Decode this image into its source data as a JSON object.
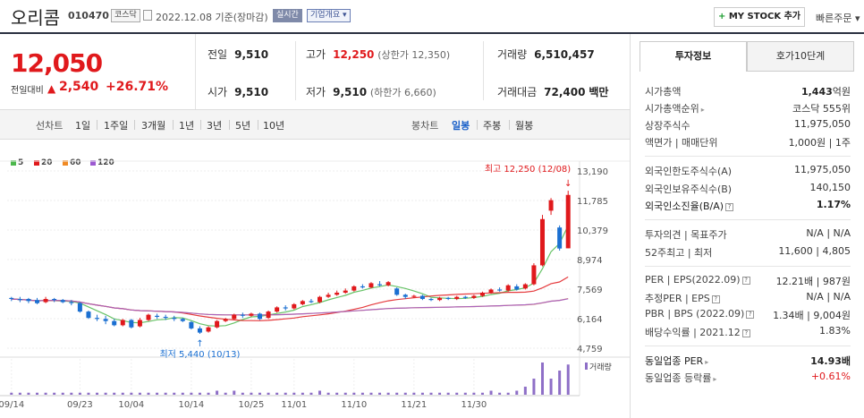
{
  "header": {
    "name": "오리콤",
    "code": "010470",
    "market_badge": "코스닥",
    "date_text": "2022.12.08 기준(장마감)",
    "realtime_badge": "실시간",
    "overview_badge": "기업개요 ▾",
    "my_stock_label": "MY STOCK 추가",
    "my_stock_plus": "+",
    "quick_order_label": "빠른주문 ▾"
  },
  "price": {
    "current": "12,050",
    "prev_label": "전일대비",
    "change_arrow": "▲",
    "change": "2,540",
    "rate": "+26.71%"
  },
  "summary": {
    "prev_close_label": "전일",
    "prev_close": "9,510",
    "high_label": "고가",
    "high": "12,250",
    "upper_limit": "(상한가 12,350)",
    "volume_label": "거래량",
    "volume": "6,510,457",
    "open_label": "시가",
    "open": "9,510",
    "low_label": "저가",
    "low": "9,510",
    "lower_limit": "(하한가 6,660)",
    "trade_value_label": "거래대금",
    "trade_value": "72,400",
    "trade_value_unit": "백만"
  },
  "range_bar": {
    "line_chart": "선차트",
    "ranges": [
      "1일",
      "1주일",
      "3개월",
      "1년",
      "3년",
      "5년",
      "10년"
    ],
    "candle_chart": "봉차트",
    "candles": [
      "일봉",
      "주봉",
      "월봉"
    ],
    "selected_candle": "일봉"
  },
  "legend": [
    {
      "label": "5",
      "color": "#4cb84c"
    },
    {
      "label": "20",
      "color": "#e0191c"
    },
    {
      "label": "60",
      "color": "#f08a24"
    },
    {
      "label": "120",
      "color": "#9c59d1"
    }
  ],
  "chart_data": {
    "type": "candlestick",
    "title": "",
    "x_ticks": [
      "09/14",
      "09/23",
      "10/04",
      "10/14",
      "10/25",
      "11/01",
      "11/10",
      "11/21",
      "11/30"
    ],
    "y_ticks": [
      13190,
      11785,
      10379,
      8974,
      7569,
      6164,
      4759
    ],
    "ylim": [
      4759,
      13190
    ],
    "high_annotation": "최고 12,250 (12/08)",
    "low_annotation": "최저 5,440 (10/13)",
    "volume_label": "거래량",
    "candles": [
      {
        "o": 7150,
        "c": 7100,
        "h": 7200,
        "l": 7000,
        "v": 1
      },
      {
        "o": 7100,
        "c": 7050,
        "h": 7200,
        "l": 6950,
        "v": 1
      },
      {
        "o": 7100,
        "c": 7000,
        "h": 7150,
        "l": 6900,
        "v": 1
      },
      {
        "o": 7050,
        "c": 6900,
        "h": 7150,
        "l": 6850,
        "v": 1
      },
      {
        "o": 6950,
        "c": 7100,
        "h": 7200,
        "l": 6900,
        "v": 1
      },
      {
        "o": 7100,
        "c": 7050,
        "h": 7150,
        "l": 6950,
        "v": 1
      },
      {
        "o": 7050,
        "c": 6950,
        "h": 7100,
        "l": 6900,
        "v": 1
      },
      {
        "o": 6950,
        "c": 6900,
        "h": 7050,
        "l": 6800,
        "v": 1
      },
      {
        "o": 6900,
        "c": 6500,
        "h": 6950,
        "l": 6450,
        "v": 1
      },
      {
        "o": 6500,
        "c": 6200,
        "h": 6550,
        "l": 6150,
        "v": 1
      },
      {
        "o": 6200,
        "c": 6150,
        "h": 6350,
        "l": 6050,
        "v": 1
      },
      {
        "o": 6150,
        "c": 6050,
        "h": 6300,
        "l": 5900,
        "v": 1
      },
      {
        "o": 6050,
        "c": 5850,
        "h": 6150,
        "l": 5800,
        "v": 1
      },
      {
        "o": 5850,
        "c": 6100,
        "h": 6150,
        "l": 5800,
        "v": 1
      },
      {
        "o": 6100,
        "c": 5750,
        "h": 6150,
        "l": 5700,
        "v": 1
      },
      {
        "o": 5800,
        "c": 6100,
        "h": 6200,
        "l": 5750,
        "v": 1
      },
      {
        "o": 6100,
        "c": 6350,
        "h": 6400,
        "l": 6050,
        "v": 1
      },
      {
        "o": 6300,
        "c": 6250,
        "h": 6400,
        "l": 6150,
        "v": 1
      },
      {
        "o": 6250,
        "c": 6200,
        "h": 6350,
        "l": 6100,
        "v": 1
      },
      {
        "o": 6200,
        "c": 6150,
        "h": 6300,
        "l": 6050,
        "v": 1
      },
      {
        "o": 6150,
        "c": 6050,
        "h": 6200,
        "l": 6000,
        "v": 1
      },
      {
        "o": 6000,
        "c": 5700,
        "h": 6050,
        "l": 5650,
        "v": 1
      },
      {
        "o": 5700,
        "c": 5500,
        "h": 5800,
        "l": 5440,
        "v": 1
      },
      {
        "o": 5550,
        "c": 5750,
        "h": 5800,
        "l": 5500,
        "v": 1
      },
      {
        "o": 5750,
        "c": 6050,
        "h": 6100,
        "l": 5700,
        "v": 2
      },
      {
        "o": 6050,
        "c": 6150,
        "h": 6200,
        "l": 6000,
        "v": 1
      },
      {
        "o": 6150,
        "c": 6350,
        "h": 6400,
        "l": 6100,
        "v": 2
      },
      {
        "o": 6350,
        "c": 6300,
        "h": 6450,
        "l": 6200,
        "v": 1
      },
      {
        "o": 6300,
        "c": 6400,
        "h": 6450,
        "l": 6250,
        "v": 1
      },
      {
        "o": 6400,
        "c": 6150,
        "h": 6450,
        "l": 6100,
        "v": 1
      },
      {
        "o": 6200,
        "c": 6500,
        "h": 6550,
        "l": 6150,
        "v": 1
      },
      {
        "o": 6500,
        "c": 6700,
        "h": 6750,
        "l": 6450,
        "v": 1
      },
      {
        "o": 6700,
        "c": 6650,
        "h": 6800,
        "l": 6550,
        "v": 1
      },
      {
        "o": 6650,
        "c": 6850,
        "h": 6900,
        "l": 6600,
        "v": 1
      },
      {
        "o": 6850,
        "c": 7000,
        "h": 7050,
        "l": 6800,
        "v": 1
      },
      {
        "o": 7000,
        "c": 6950,
        "h": 7100,
        "l": 6900,
        "v": 1
      },
      {
        "o": 6950,
        "c": 7200,
        "h": 7250,
        "l": 6900,
        "v": 2
      },
      {
        "o": 7200,
        "c": 7300,
        "h": 7400,
        "l": 7150,
        "v": 1
      },
      {
        "o": 7300,
        "c": 7400,
        "h": 7500,
        "l": 7250,
        "v": 1
      },
      {
        "o": 7400,
        "c": 7500,
        "h": 7600,
        "l": 7350,
        "v": 1
      },
      {
        "o": 7500,
        "c": 7700,
        "h": 7750,
        "l": 7450,
        "v": 1
      },
      {
        "o": 7700,
        "c": 7650,
        "h": 7800,
        "l": 7600,
        "v": 1
      },
      {
        "o": 7650,
        "c": 7850,
        "h": 7900,
        "l": 7600,
        "v": 1
      },
      {
        "o": 7800,
        "c": 7750,
        "h": 7950,
        "l": 7700,
        "v": 1
      },
      {
        "o": 7750,
        "c": 7900,
        "h": 7950,
        "l": 7700,
        "v": 1
      },
      {
        "o": 7600,
        "c": 7300,
        "h": 7650,
        "l": 7250,
        "v": 1
      },
      {
        "o": 7300,
        "c": 7200,
        "h": 7350,
        "l": 7100,
        "v": 1
      },
      {
        "o": 7200,
        "c": 7250,
        "h": 7300,
        "l": 7150,
        "v": 1
      },
      {
        "o": 7250,
        "c": 7100,
        "h": 7300,
        "l": 7050,
        "v": 1
      },
      {
        "o": 7100,
        "c": 7050,
        "h": 7150,
        "l": 7000,
        "v": 1
      },
      {
        "o": 7050,
        "c": 7150,
        "h": 7200,
        "l": 7000,
        "v": 1
      },
      {
        "o": 7150,
        "c": 7100,
        "h": 7200,
        "l": 7050,
        "v": 1
      },
      {
        "o": 7100,
        "c": 7200,
        "h": 7250,
        "l": 7050,
        "v": 1
      },
      {
        "o": 7200,
        "c": 7150,
        "h": 7250,
        "l": 7100,
        "v": 1
      },
      {
        "o": 7150,
        "c": 7250,
        "h": 7300,
        "l": 7100,
        "v": 1
      },
      {
        "o": 7250,
        "c": 7400,
        "h": 7450,
        "l": 7200,
        "v": 1
      },
      {
        "o": 7400,
        "c": 7550,
        "h": 7600,
        "l": 7350,
        "v": 2
      },
      {
        "o": 7550,
        "c": 7500,
        "h": 7650,
        "l": 7450,
        "v": 1
      },
      {
        "o": 7500,
        "c": 7750,
        "h": 7800,
        "l": 7450,
        "v": 1
      },
      {
        "o": 7700,
        "c": 7550,
        "h": 7800,
        "l": 7500,
        "v": 2
      },
      {
        "o": 7600,
        "c": 7800,
        "h": 7850,
        "l": 7550,
        "v": 4
      },
      {
        "o": 7800,
        "c": 8700,
        "h": 8800,
        "l": 7750,
        "v": 8
      },
      {
        "o": 8700,
        "c": 10900,
        "h": 11100,
        "l": 8650,
        "v": 16
      },
      {
        "o": 11300,
        "c": 11800,
        "h": 11900,
        "l": 11100,
        "v": 8
      },
      {
        "o": 10500,
        "c": 9500,
        "h": 10600,
        "l": 9400,
        "v": 12
      },
      {
        "o": 9510,
        "c": 12050,
        "h": 12250,
        "l": 9510,
        "v": 15
      }
    ]
  },
  "sidebar": {
    "tab_active": "투자정보",
    "tab_inactive": "호가10단계",
    "group1": [
      {
        "k": "시가총액",
        "v_bold": "1,443",
        "v_unit": "억원"
      },
      {
        "k": "시가총액순위",
        "v": "코스닥 555위",
        "arrow": true
      },
      {
        "k": "상장주식수",
        "v": "11,975,050"
      },
      {
        "k": "액면가 | 매매단위",
        "v": "1,000원 | 1주"
      }
    ],
    "group2": [
      {
        "k": "외국인한도주식수(A)",
        "v": "11,975,050"
      },
      {
        "k": "외국인보유주식수(B)",
        "v": "140,150"
      },
      {
        "k": "외국인소진율(B/A)",
        "v": "1.17%",
        "bold": true
      }
    ],
    "group3": [
      {
        "k": "투자의견 | 목표주가",
        "v": "N/A | N/A"
      },
      {
        "k": "52주최고 | 최저",
        "v": "11,600 | 4,805"
      }
    ],
    "group4": [
      {
        "k": "PER | EPS(2022.09)",
        "v": "12.21배 | 987원"
      },
      {
        "k": "추정PER | EPS",
        "v": "N/A | N/A"
      },
      {
        "k": "PBR | BPS (2022.09)",
        "v": "1.34배 | 9,004원"
      },
      {
        "k": "배당수익률 | 2021.12",
        "v": "1.83%"
      }
    ],
    "group5": [
      {
        "k": "동일업종 PER",
        "v": "14.93배",
        "bold": true
      },
      {
        "k": "동일업종 등락률",
        "v": "+0.61%",
        "red": true
      }
    ]
  }
}
